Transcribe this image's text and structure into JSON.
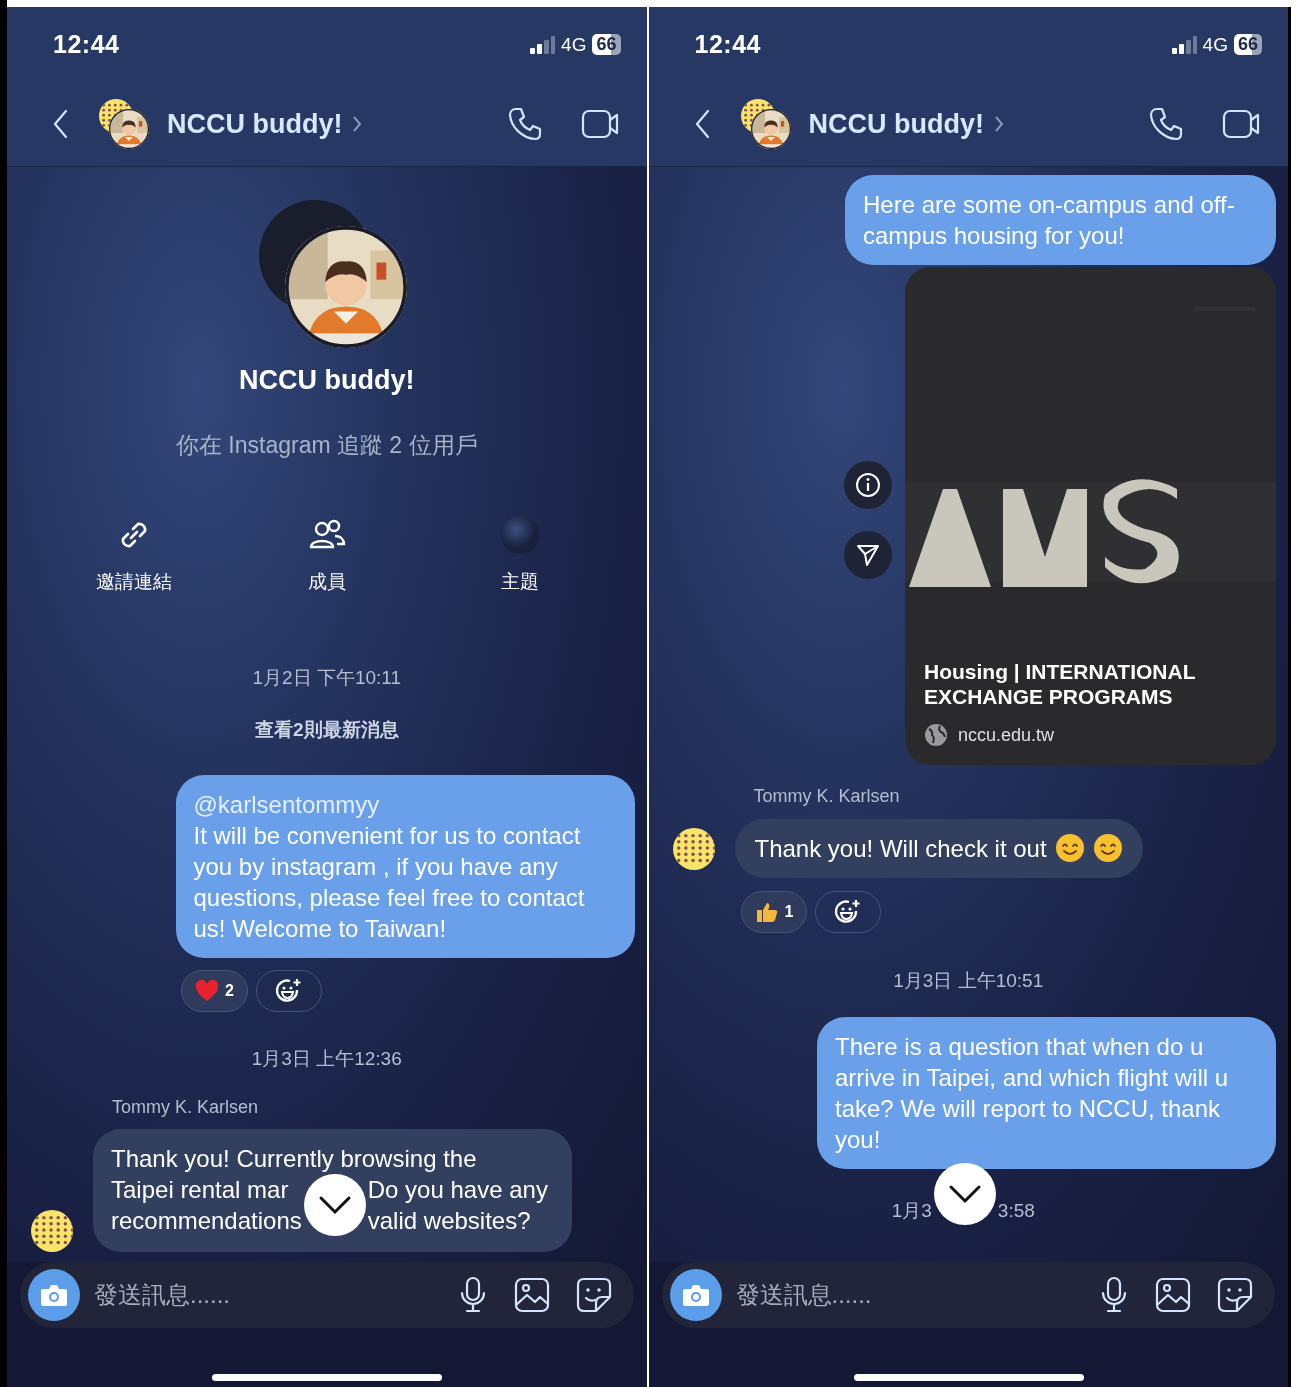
{
  "screens": [
    {
      "status_bar": {
        "time": "12:44",
        "network": "4G",
        "battery": "66"
      },
      "header": {
        "title": "NCCU buddy!"
      },
      "profile": {
        "name": "NCCU buddy!",
        "subtitle": "你在 Instagram 追蹤 2 位用戶"
      },
      "actions": [
        {
          "kind": "link",
          "label": "邀請連結"
        },
        {
          "kind": "members",
          "label": "成員"
        },
        {
          "kind": "theme",
          "label": "主題"
        }
      ],
      "messages": [
        {
          "kind": "timestamp",
          "text": "1月2日 下午10:11"
        },
        {
          "kind": "notice",
          "text": "查看2則最新消息"
        },
        {
          "kind": "outgoing",
          "mention": "@karlsentommyy",
          "text": "It will be convenient for us to contact you by instagram , if you have any questions, please feel free to contact us! Welcome to Taiwan!",
          "reactions": [
            {
              "kind": "heart",
              "count": "2"
            },
            {
              "kind": "add"
            }
          ]
        },
        {
          "kind": "timestamp",
          "text": "1月3日 上午12:36"
        },
        {
          "kind": "sender",
          "text": "Tommy K. Karlsen"
        },
        {
          "kind": "incoming",
          "lines": [
            [
              "Thank you! Currently browsing the"
            ],
            [
              "Taipei rental mar",
              "Do you have any"
            ],
            [
              "recommendations",
              "valid websites?"
            ]
          ]
        }
      ],
      "composer": {
        "placeholder": "發送訊息......"
      }
    },
    {
      "status_bar": {
        "time": "12:44",
        "network": "4G",
        "battery": "66"
      },
      "header": {
        "title": "NCCU buddy!"
      },
      "messages": [
        {
          "kind": "outgoing",
          "text": "Here are some on-campus and off-campus housing for you!"
        },
        {
          "kind": "link_card",
          "title": "Housing | INTERNATIONAL EXCHANGE PROGRAMS",
          "domain": "nccu.edu.tw"
        },
        {
          "kind": "sender",
          "text": "Tommy K. Karlsen"
        },
        {
          "kind": "incoming",
          "text": "Thank you! Will check it out",
          "emoji": [
            {
              "kind": "smile"
            },
            {
              "kind": "smile"
            }
          ],
          "reactions": [
            {
              "kind": "thumbs_up",
              "count": "1"
            },
            {
              "kind": "add"
            }
          ]
        },
        {
          "kind": "timestamp",
          "text": "1月3日 上午10:51"
        },
        {
          "kind": "outgoing",
          "text": "There is a question that when do u arrive in Taipei, and which flight will u take? We will report to NCCU, thank you!"
        },
        {
          "kind": "timestamp",
          "segments": [
            "1月3",
            "3:58"
          ]
        }
      ],
      "composer": {
        "placeholder": "發送訊息......"
      }
    }
  ]
}
